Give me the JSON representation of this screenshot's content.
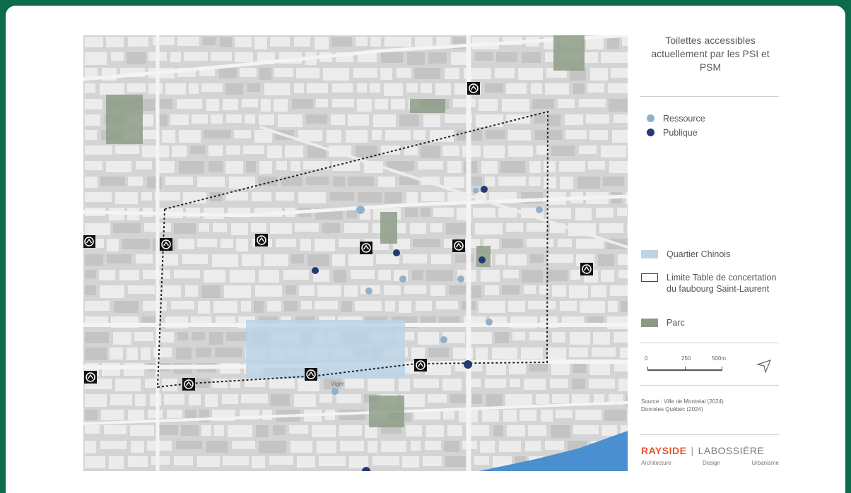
{
  "legend": {
    "title": "Toilettes accessibles actuellement par les PSI et PSM",
    "items": [
      {
        "label": "Ressource",
        "color": "#8fb1cc"
      },
      {
        "label": "Publique",
        "color": "#233a73"
      }
    ],
    "areas": [
      {
        "label": "Quartier Chinois",
        "color": "#bcd4e6"
      },
      {
        "label": "Limite Table de concertation du faubourg Saint-Laurent",
        "color": "#ffffff"
      },
      {
        "label": "Parc",
        "color": "#8c9a84"
      }
    ]
  },
  "scale": {
    "labels": [
      "0",
      "250",
      "500m"
    ]
  },
  "source": {
    "line1": "Source : Ville de Montréal (2024)",
    "line2": "Données Québec (2024)"
  },
  "brand": {
    "name1": "RAYSIDE",
    "name2": "LABOSSIÈRE",
    "sub": [
      "Architecture",
      "Design",
      "Urbanisme"
    ]
  },
  "map": {
    "street_labels": [
      "Viger"
    ],
    "colors": {
      "water": "#4a8fd0",
      "block": "#ececec",
      "street": "#d4d4d4"
    }
  }
}
